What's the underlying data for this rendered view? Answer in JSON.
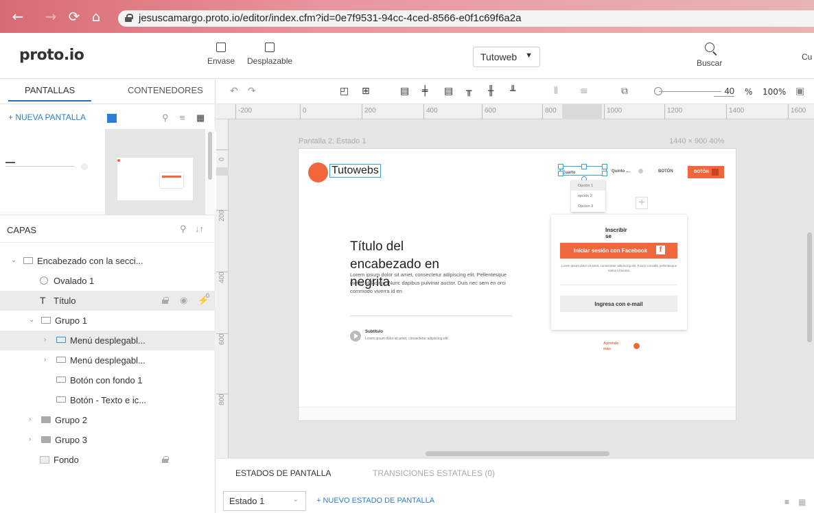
{
  "browser": {
    "url": "jesuscamargo.proto.io/editor/index.cfm?id=0e7f9531-94cc-4ced-8566-e0f1c69f6a2a",
    "back_icon": "←",
    "forward_icon": "→",
    "reload_icon": "⟳",
    "home_icon": "⌂"
  },
  "header": {
    "logo": "proto.io",
    "envase": "Envase",
    "desplazable": "Desplazable",
    "project": "Tutoweb",
    "project_caret": "▼",
    "buscar": "Buscar",
    "cut": "Cu"
  },
  "left": {
    "tab_pantallas": "PANTALLAS",
    "tab_contenedores": "CONTENEDORES",
    "new_screen": "+ NUEVA PANTALLA",
    "capas": "CAPAS",
    "layers": [
      {
        "label": "Encabezado con la secci...",
        "arrow": "⌄",
        "icon": "folder",
        "selected": false
      },
      {
        "label": "Ovalado 1",
        "arrow": "",
        "icon": "oval",
        "selected": false
      },
      {
        "label": "Título",
        "arrow": "",
        "icon": "text",
        "selected": true,
        "badge": "0"
      },
      {
        "label": "Grupo 1",
        "arrow": "⌄",
        "icon": "folder",
        "selected": false
      },
      {
        "label": "Menú desplegabl...",
        "arrow": "›",
        "icon": "component",
        "selected": true
      },
      {
        "label": "Menú desplegabl...",
        "arrow": "›",
        "icon": "component",
        "selected": false
      },
      {
        "label": "Botón con fondo 1",
        "arrow": "",
        "icon": "component",
        "selected": false
      },
      {
        "label": "Botón - Texto e ic...",
        "arrow": "",
        "icon": "component",
        "selected": false
      },
      {
        "label": "Grupo 2",
        "arrow": "›",
        "icon": "folder-filled",
        "selected": false
      },
      {
        "label": "Grupo 3",
        "arrow": "›",
        "icon": "folder-filled",
        "selected": false
      },
      {
        "label": "Fondo",
        "arrow": "",
        "icon": "rect",
        "selected": false
      }
    ],
    "text_icon": "T"
  },
  "toolbar": {
    "zoom": "40",
    "percent": "%",
    "full": "100%"
  },
  "ruler": {
    "h": [
      "-200",
      "0",
      "200",
      "400",
      "600",
      "800",
      "1000",
      "1200",
      "1400",
      "1600"
    ],
    "v": [
      "0",
      "200",
      "400",
      "600",
      "800"
    ]
  },
  "canvas": {
    "screen_label": "Pantalla 2: Estado 1",
    "screen_size": "1440 × 900  40%",
    "site_name": "Tutowebs",
    "nav_1": "Cuarto",
    "nav_2": "Quinto ...",
    "nav_3": "BOTÓN",
    "top_button": "BOTÓN",
    "dropdown": [
      "Opción 1",
      "opción 2",
      "Opcion 3"
    ],
    "hero_title": "Título del encabezado en negrita",
    "hero_body": "Lorem ipsum dolor sit amet, consectetur adipiscing elit. Pellentesque metus id lacinia. Nunc dapibus pulvinar auctor. Duis nec sem en orci commodo viverra id en",
    "subtitle": "Subtítulo",
    "subtitle_text": "Lorem ipsum dolor sit amet, consectetur adipiscing elit.",
    "card_title": "Inscribir se",
    "fb_button": "Iniciar sesión con Facebook",
    "card_small": "Lorem ipsum dolor sit amet, consectetur adipiscing elit. Fusce convallis pellentesque metus id lacinia.",
    "email_button": "Ingresa con e-mail",
    "learn_more": "Aprende más"
  },
  "bottom": {
    "tab_estados": "ESTADOS DE PANTALLA",
    "tab_transiciones": "TRANSICIONES ESTATALES (0)",
    "estado": "Estado 1",
    "new_state": "+ NUEVO ESTADO DE PANTALLA"
  },
  "colors": {
    "accent": "#f0663d",
    "link": "#2a7fd4",
    "selection": "#3c9ed9"
  }
}
